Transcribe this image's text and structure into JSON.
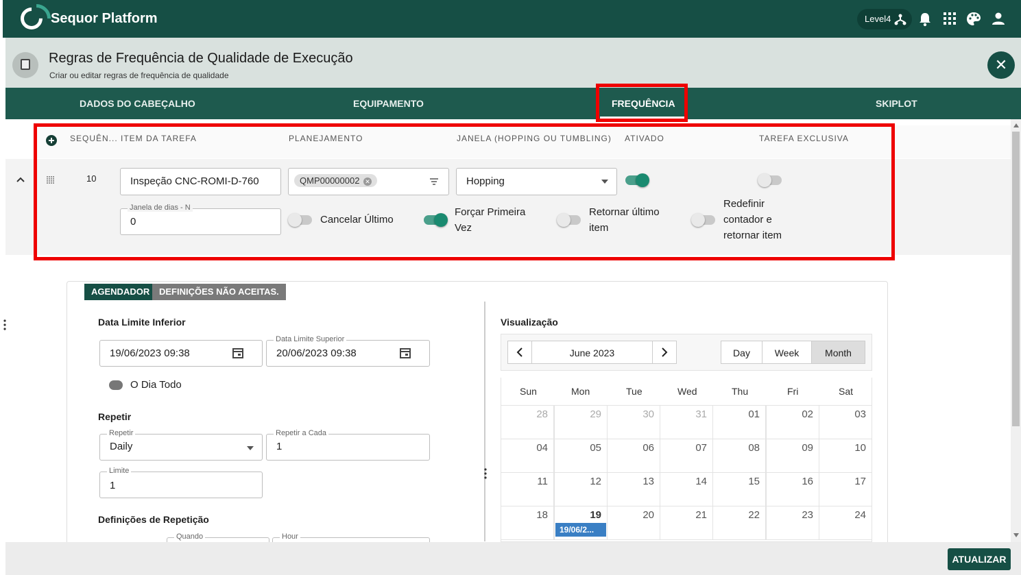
{
  "app": {
    "title": "Sequor Platform",
    "level": "Level4"
  },
  "header": {
    "title": "Regras de Frequência de Qualidade de Execução",
    "subtitle": "Criar ou editar regras de frequência de qualidade"
  },
  "tabs": [
    {
      "label": "DADOS DO CABEÇALHO"
    },
    {
      "label": "EQUIPAMENTO"
    },
    {
      "label": "FREQUÊNCIA"
    },
    {
      "label": "SKIPLOT"
    }
  ],
  "table": {
    "headers": [
      "SEQUÊN...",
      "ITEM DA TAREFA",
      "PLANEJAMENTO",
      "JANELA (HOPPING OU TUMBLING)",
      "ATIVADO",
      "TAREFA EXCLUSIVA"
    ],
    "row": {
      "sequence": "10",
      "item": "Inspeção CNC-ROMI-D-760",
      "planning_chip": "QMP00000002",
      "window": "Hopping",
      "ativado": true,
      "exclusiva": false,
      "days_label": "Janela de dias - N",
      "days_value": "0",
      "cancel_last": "Cancelar Último",
      "force_first_l1": "Forçar Primeira",
      "force_first_l2": "Vez",
      "return_last_l1": "Retornar último",
      "return_last_l2": "item",
      "reset_l1": "Redefinir",
      "reset_l2": "contador e",
      "reset_l3": "retornar item"
    }
  },
  "scheduler": {
    "tab_active": "AGENDADOR",
    "tab_other": "DEFINIÇÕES NÃO ACEITAS.",
    "lower_date_title": "Data Limite Inferior",
    "lower_date": "19/06/2023 09:38",
    "upper_date_label": "Data Limite Superior",
    "upper_date": "20/06/2023 09:38",
    "all_day": "O Dia Todo",
    "repeat_title": "Repetir",
    "repeat_label": "Repetir",
    "repeat_value": "Daily",
    "repeat_every_label": "Repetir a Cada",
    "repeat_every_value": "1",
    "limit_label": "Limite",
    "limit_value": "1",
    "repeat_defs_title": "Definições de Repetição",
    "when_label": "Quando",
    "hour_label": "Hour"
  },
  "preview": {
    "title": "Visualização",
    "month": "June 2023",
    "views": [
      "Day",
      "Week",
      "Month"
    ],
    "days_of_week": [
      "Sun",
      "Mon",
      "Tue",
      "Wed",
      "Thu",
      "Fri",
      "Sat"
    ],
    "weeks": [
      [
        "28",
        "29",
        "30",
        "31",
        "01",
        "02",
        "03"
      ],
      [
        "04",
        "05",
        "06",
        "07",
        "08",
        "09",
        "10"
      ],
      [
        "11",
        "12",
        "13",
        "14",
        "15",
        "16",
        "17"
      ],
      [
        "18",
        "19",
        "20",
        "21",
        "22",
        "23",
        "24"
      ]
    ],
    "event": "19/06/2..."
  },
  "footer": {
    "update": "ATUALIZAR"
  }
}
